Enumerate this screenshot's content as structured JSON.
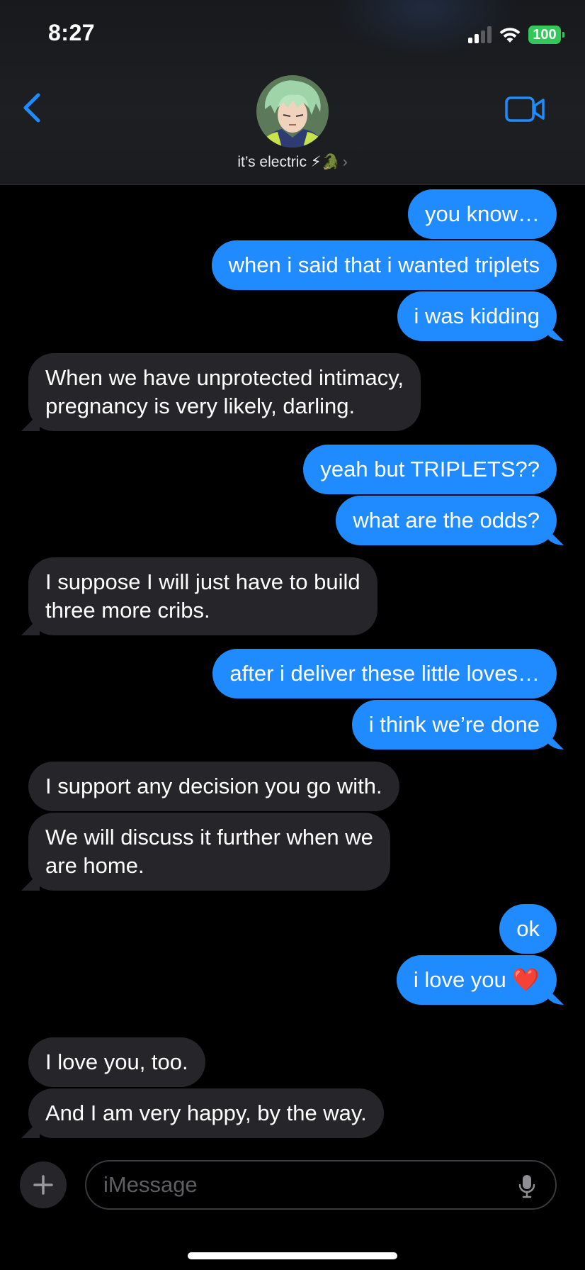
{
  "status_bar": {
    "time": "8:27",
    "battery": "100"
  },
  "header": {
    "contact_name": "it’s electric ⚡🐊",
    "chevron": "›"
  },
  "messages": [
    {
      "text": "you know…"
    },
    {
      "text": "when i said that i wanted triplets"
    },
    {
      "text": "i was kidding"
    },
    {
      "text": "When we have unprotected intimacy,"
    },
    {
      "text": "pregnancy is very likely, darling."
    },
    {
      "text": "yeah but TRIPLETS??"
    },
    {
      "text": "what are the odds?"
    },
    {
      "text": "I suppose I will just have to build"
    },
    {
      "text": "three more cribs."
    },
    {
      "text": "after i deliver these little loves…"
    },
    {
      "text": "i think we’re done"
    },
    {
      "text": "I support any decision you go with."
    },
    {
      "text": "We will discuss it further when we"
    },
    {
      "text": "are home."
    },
    {
      "text": "ok"
    },
    {
      "text": "i love you ❤️"
    },
    {
      "text": "I love you, too."
    },
    {
      "text": "And I am very happy, by the way."
    }
  ],
  "input": {
    "placeholder": "iMessage"
  },
  "icons": {
    "back": "chevron-left-icon",
    "video": "video-camera-icon",
    "plus": "plus-icon",
    "mic": "microphone-icon",
    "wifi": "wifi-icon",
    "signal": "cellular-signal-icon"
  },
  "colors": {
    "outgoing": "#1f8bff",
    "incoming": "#26262a",
    "accent": "#1e8cff",
    "battery": "#34c759"
  }
}
